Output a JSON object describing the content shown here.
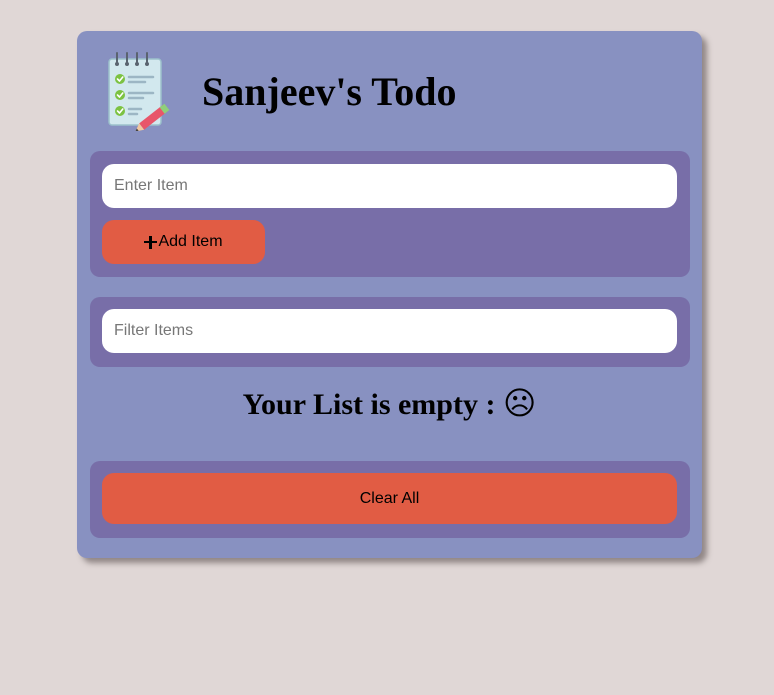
{
  "app": {
    "title": "Sanjeev's Todo",
    "logo_icon": "notepad-checklist-icon"
  },
  "add_item": {
    "input_value": "",
    "input_placeholder": "Enter Item",
    "button_label": "Add Item",
    "button_icon": "plus-icon"
  },
  "filter": {
    "input_value": "",
    "input_placeholder": "Filter Items"
  },
  "list": {
    "empty_message": "Your List is empty : ",
    "empty_icon_glyph": "☹",
    "empty_icon": "frown-face-icon"
  },
  "actions": {
    "clear_label": "Clear All"
  },
  "colors": {
    "page_background": "#e0d7d6",
    "card_background": "#8891c1",
    "panel_background": "#786ea8",
    "button_accent": "#e15c44"
  }
}
